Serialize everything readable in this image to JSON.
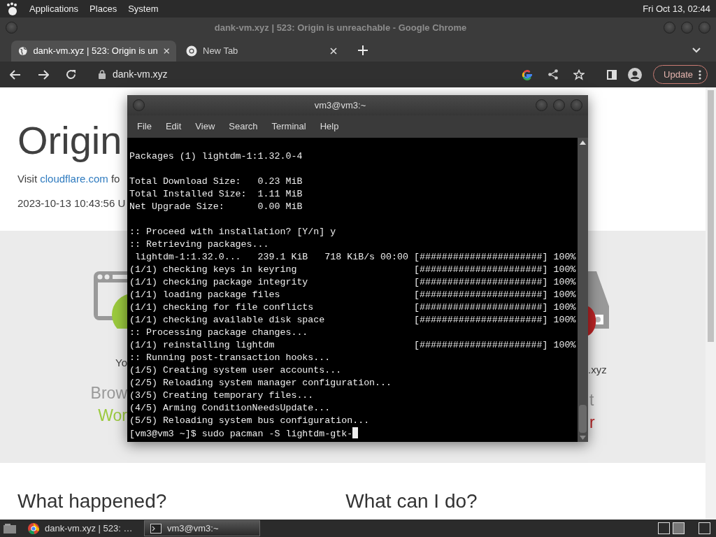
{
  "top_panel": {
    "menus": [
      "Applications",
      "Places",
      "System"
    ],
    "clock": "Fri Oct 13, 02:44"
  },
  "browser": {
    "title": "dank-vm.xyz | 523: Origin is unreachable - Google Chrome",
    "tabs": [
      {
        "label": "dank-vm.xyz | 523: Origin is un",
        "selected": true
      },
      {
        "label": "New Tab",
        "selected": false
      }
    ],
    "address": "dank-vm.xyz",
    "update_button": "Update",
    "page": {
      "heading": "Origin",
      "visit": "Visit ",
      "link": "cloudflare.com",
      "visit_rest": " fo",
      "timestamp": "2023-10-13 10:43:56 U",
      "left_status": {
        "lines": [
          "Yo",
          "Brow",
          "Wor"
        ],
        "color": "#9bca3e"
      },
      "right_status": {
        "lines": [
          ".xyz",
          "t",
          "r"
        ],
        "color": "#bd2426"
      },
      "sections": [
        "What happened?",
        "What can I do?"
      ]
    }
  },
  "terminal": {
    "title": "vm3@vm3:~",
    "menu": [
      "File",
      "Edit",
      "View",
      "Search",
      "Terminal",
      "Help"
    ],
    "blocks": [
      [
        "Packages (1) lightdm-1:1.32.0-4"
      ],
      [
        "Total Download Size:   0.23 MiB",
        "Total Installed Size:  1.11 MiB",
        "Net Upgrade Size:      0.00 MiB"
      ],
      [
        ":: Proceed with installation? [Y/n] y",
        ":: Retrieving packages...",
        " lightdm-1:1.32.0...   239.1 KiB   718 KiB/s 00:00 [######################] 100%",
        "(1/1) checking keys in keyring                     [######################] 100%",
        "(1/1) checking package integrity                   [######################] 100%",
        "(1/1) loading package files                        [######################] 100%",
        "(1/1) checking for file conflicts                  [######################] 100%",
        "(1/1) checking available disk space                [######################] 100%",
        ":: Processing package changes...",
        "(1/1) reinstalling lightdm                         [######################] 100%",
        ":: Running post-transaction hooks...",
        "(1/5) Creating system user accounts...",
        "(2/5) Reloading system manager configuration...",
        "(3/5) Creating temporary files...",
        "(4/5) Arming ConditionNeedsUpdate...",
        "(5/5) Reloading system bus configuration..."
      ]
    ],
    "prompt": "[vm3@vm3 ~]$ sudo pacman -S lightdm-gtk-"
  },
  "taskbar": {
    "items": [
      {
        "label": "dank-vm.xyz | 523: …",
        "selected": false,
        "kind": "browser"
      },
      {
        "label": "vm3@vm3:~",
        "selected": true,
        "kind": "terminal"
      }
    ]
  }
}
